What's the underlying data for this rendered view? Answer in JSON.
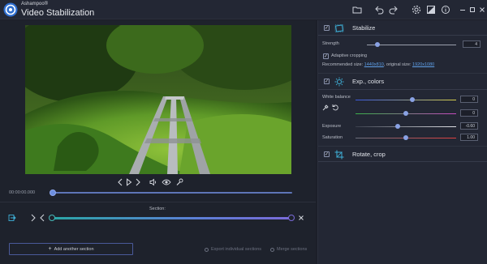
{
  "app": {
    "brand": "Ashampoo®",
    "title": "Video Stabilization"
  },
  "player": {
    "timecode": "00:00:00.000",
    "position_fraction": 0.0
  },
  "section": {
    "label": "Section:",
    "range_start_fraction": 0.0,
    "range_end_fraction": 1.0
  },
  "footer": {
    "add_section": "Add another section",
    "export_individual": "Export individual sections",
    "merge_sections": "Merge sections"
  },
  "stabilize": {
    "title": "Stabilize",
    "enabled": true,
    "strength_label": "Strength",
    "strength_value": "4",
    "strength_fraction": 0.18,
    "adaptive_label": "Adaptive cropping",
    "adaptive_checked": true,
    "recommended_label": "Recommended size:",
    "recommended_value": "1440x810",
    "original_label": ", original size:",
    "original_value": "1920x1080"
  },
  "colors": {
    "title": "Exp., colors",
    "enabled": true,
    "white_balance_label": "White balance",
    "wb1_value": "0",
    "wb1_fraction": 0.55,
    "wb2_value": "0",
    "wb2_fraction": 0.5,
    "exposure_label": "Exposure",
    "exposure_value": "-0.60",
    "exposure_fraction": 0.42,
    "saturation_label": "Saturation",
    "saturation_value": "1.00",
    "saturation_fraction": 0.5
  },
  "rotate": {
    "title": "Rotate, crop",
    "enabled": true
  },
  "colors_theme": {
    "accent": "#5c7fd6",
    "teal": "#2aa6a6"
  }
}
